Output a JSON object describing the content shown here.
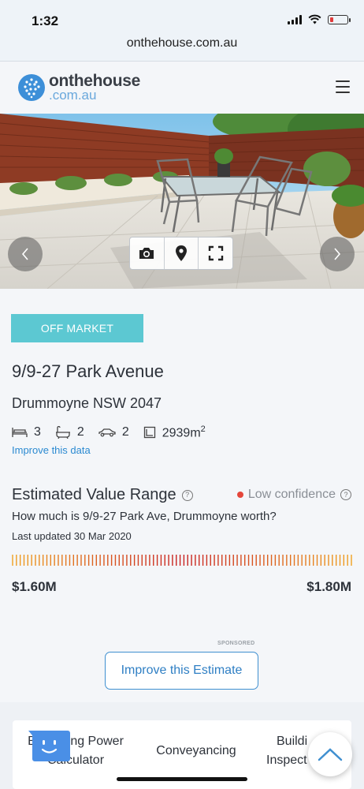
{
  "status_bar": {
    "time": "1:32"
  },
  "browser": {
    "url": "onthehouse.com.au"
  },
  "header": {
    "logo_main": "onthehouse",
    "logo_sub": ".com.au"
  },
  "listing": {
    "status_badge": "OFF MARKET",
    "address_line1": "9/9-27 Park Avenue",
    "address_line2": "Drummoyne NSW 2047",
    "features": {
      "beds": "3",
      "baths": "2",
      "cars": "2",
      "land_area": "2939m",
      "land_area_unit_sup": "2"
    },
    "improve_data_link": "Improve this data"
  },
  "estimate": {
    "title": "Estimated Value Range",
    "confidence": "Low confidence",
    "confidence_color": "#e4463b",
    "question": "How much is 9/9-27 Park Ave, Drummoyne worth?",
    "last_updated": "Last updated 30 Mar 2020",
    "low": "$1.60M",
    "high": "$1.80M",
    "sponsored_label": "SPONSORED",
    "improve_button": "Improve this Estimate"
  },
  "tools": [
    {
      "label_line1": "Borrowing Power",
      "label_line2": "Calculator"
    },
    {
      "label_line1": "Conveyancing",
      "label_line2": ""
    },
    {
      "label_line1": "Buildi",
      "label_line2": "Inspect"
    }
  ],
  "colors": {
    "accent": "#2b8ad1",
    "badge": "#5cc8d2",
    "range_low": "#f0a020",
    "range_mid": "#c82020"
  },
  "icons": {
    "nav_prev": "chevron-left-icon",
    "nav_next": "chevron-right-icon",
    "photos": "camera-icon",
    "map": "map-pin-icon",
    "fullscreen": "fullscreen-icon",
    "beds": "bed-icon",
    "baths": "bath-icon",
    "cars": "car-icon",
    "land": "land-area-icon",
    "help": "question-circle-icon",
    "scroll_top": "chevron-up-icon",
    "chat": "chat-bot-icon"
  }
}
